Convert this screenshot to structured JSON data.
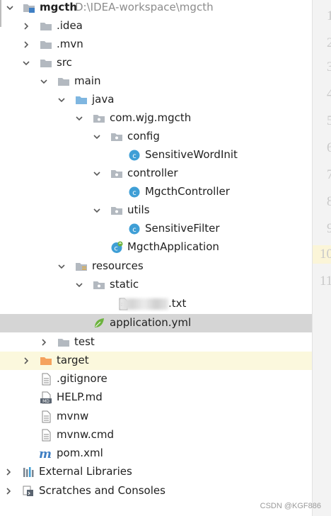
{
  "tree": {
    "project": {
      "name": "mgcth",
      "path": "D:\\IDEA-workspace\\mgcth"
    },
    "idea": ".idea",
    "mvn": ".mvn",
    "src": "src",
    "main": "main",
    "java": "java",
    "package": "com.wjg.mgcth",
    "config": "config",
    "sensitive_word_init": "SensitiveWordInit",
    "controller": "controller",
    "mgcth_controller": "MgcthController",
    "utils": "utils",
    "sensitive_filter": "SensitiveFilter",
    "mgcth_application": "MgcthApplication",
    "resources": "resources",
    "static": "static",
    "txt_file_suffix": ".txt",
    "application_yml": "application.yml",
    "test": "test",
    "target": "target",
    "gitignore": ".gitignore",
    "help_md": "HELP.md",
    "mvnw": "mvnw",
    "mvnw_cmd": "mvnw.cmd",
    "pom_xml": "pom.xml",
    "external_libraries": "External Libraries",
    "scratches": "Scratches and Consoles"
  },
  "gutter": {
    "lines": [
      "1",
      "2",
      "3",
      "4",
      "5",
      "6",
      "7",
      "8",
      "9",
      "10",
      "11"
    ]
  },
  "watermark": "CSDN @KGF886",
  "colors": {
    "folder": "#b3b9c0",
    "source_folder": "#7fb6e0",
    "excluded_folder": "#f5a25d",
    "class_icon": "#3f9fd6",
    "spring_green": "#6db33f",
    "selection": "#d5d5d5",
    "excluded_row": "#fbf8dd"
  }
}
